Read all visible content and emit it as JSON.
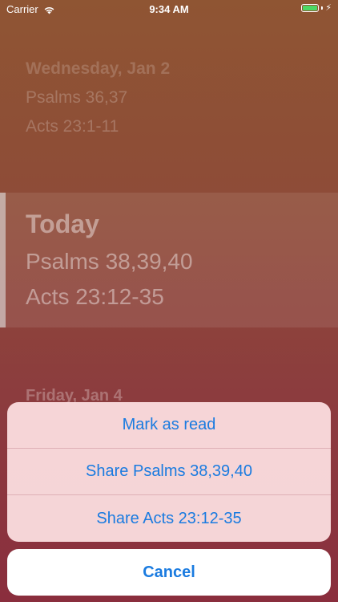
{
  "status_bar": {
    "carrier": "Carrier",
    "time": "9:34 AM",
    "battery_level": 1.0,
    "battery_color": "#4cd964",
    "icons": [
      "wifi-icon",
      "battery-icon",
      "charging-bolt-icon"
    ]
  },
  "readings": {
    "previous": {
      "title": "Wednesday, Jan 2",
      "items": [
        "Psalms 36,37",
        "Acts 23:1-11"
      ]
    },
    "today": {
      "title": "Today",
      "items": [
        "Psalms 38,39,40",
        "Acts 23:12-35"
      ]
    },
    "next": {
      "title": "Friday, Jan 4"
    }
  },
  "action_sheet": {
    "items": [
      "Mark as read",
      "Share Psalms 38,39,40",
      "Share Acts 23:12-35"
    ],
    "cancel_label": "Cancel",
    "accent_color": "#1a7be0"
  }
}
